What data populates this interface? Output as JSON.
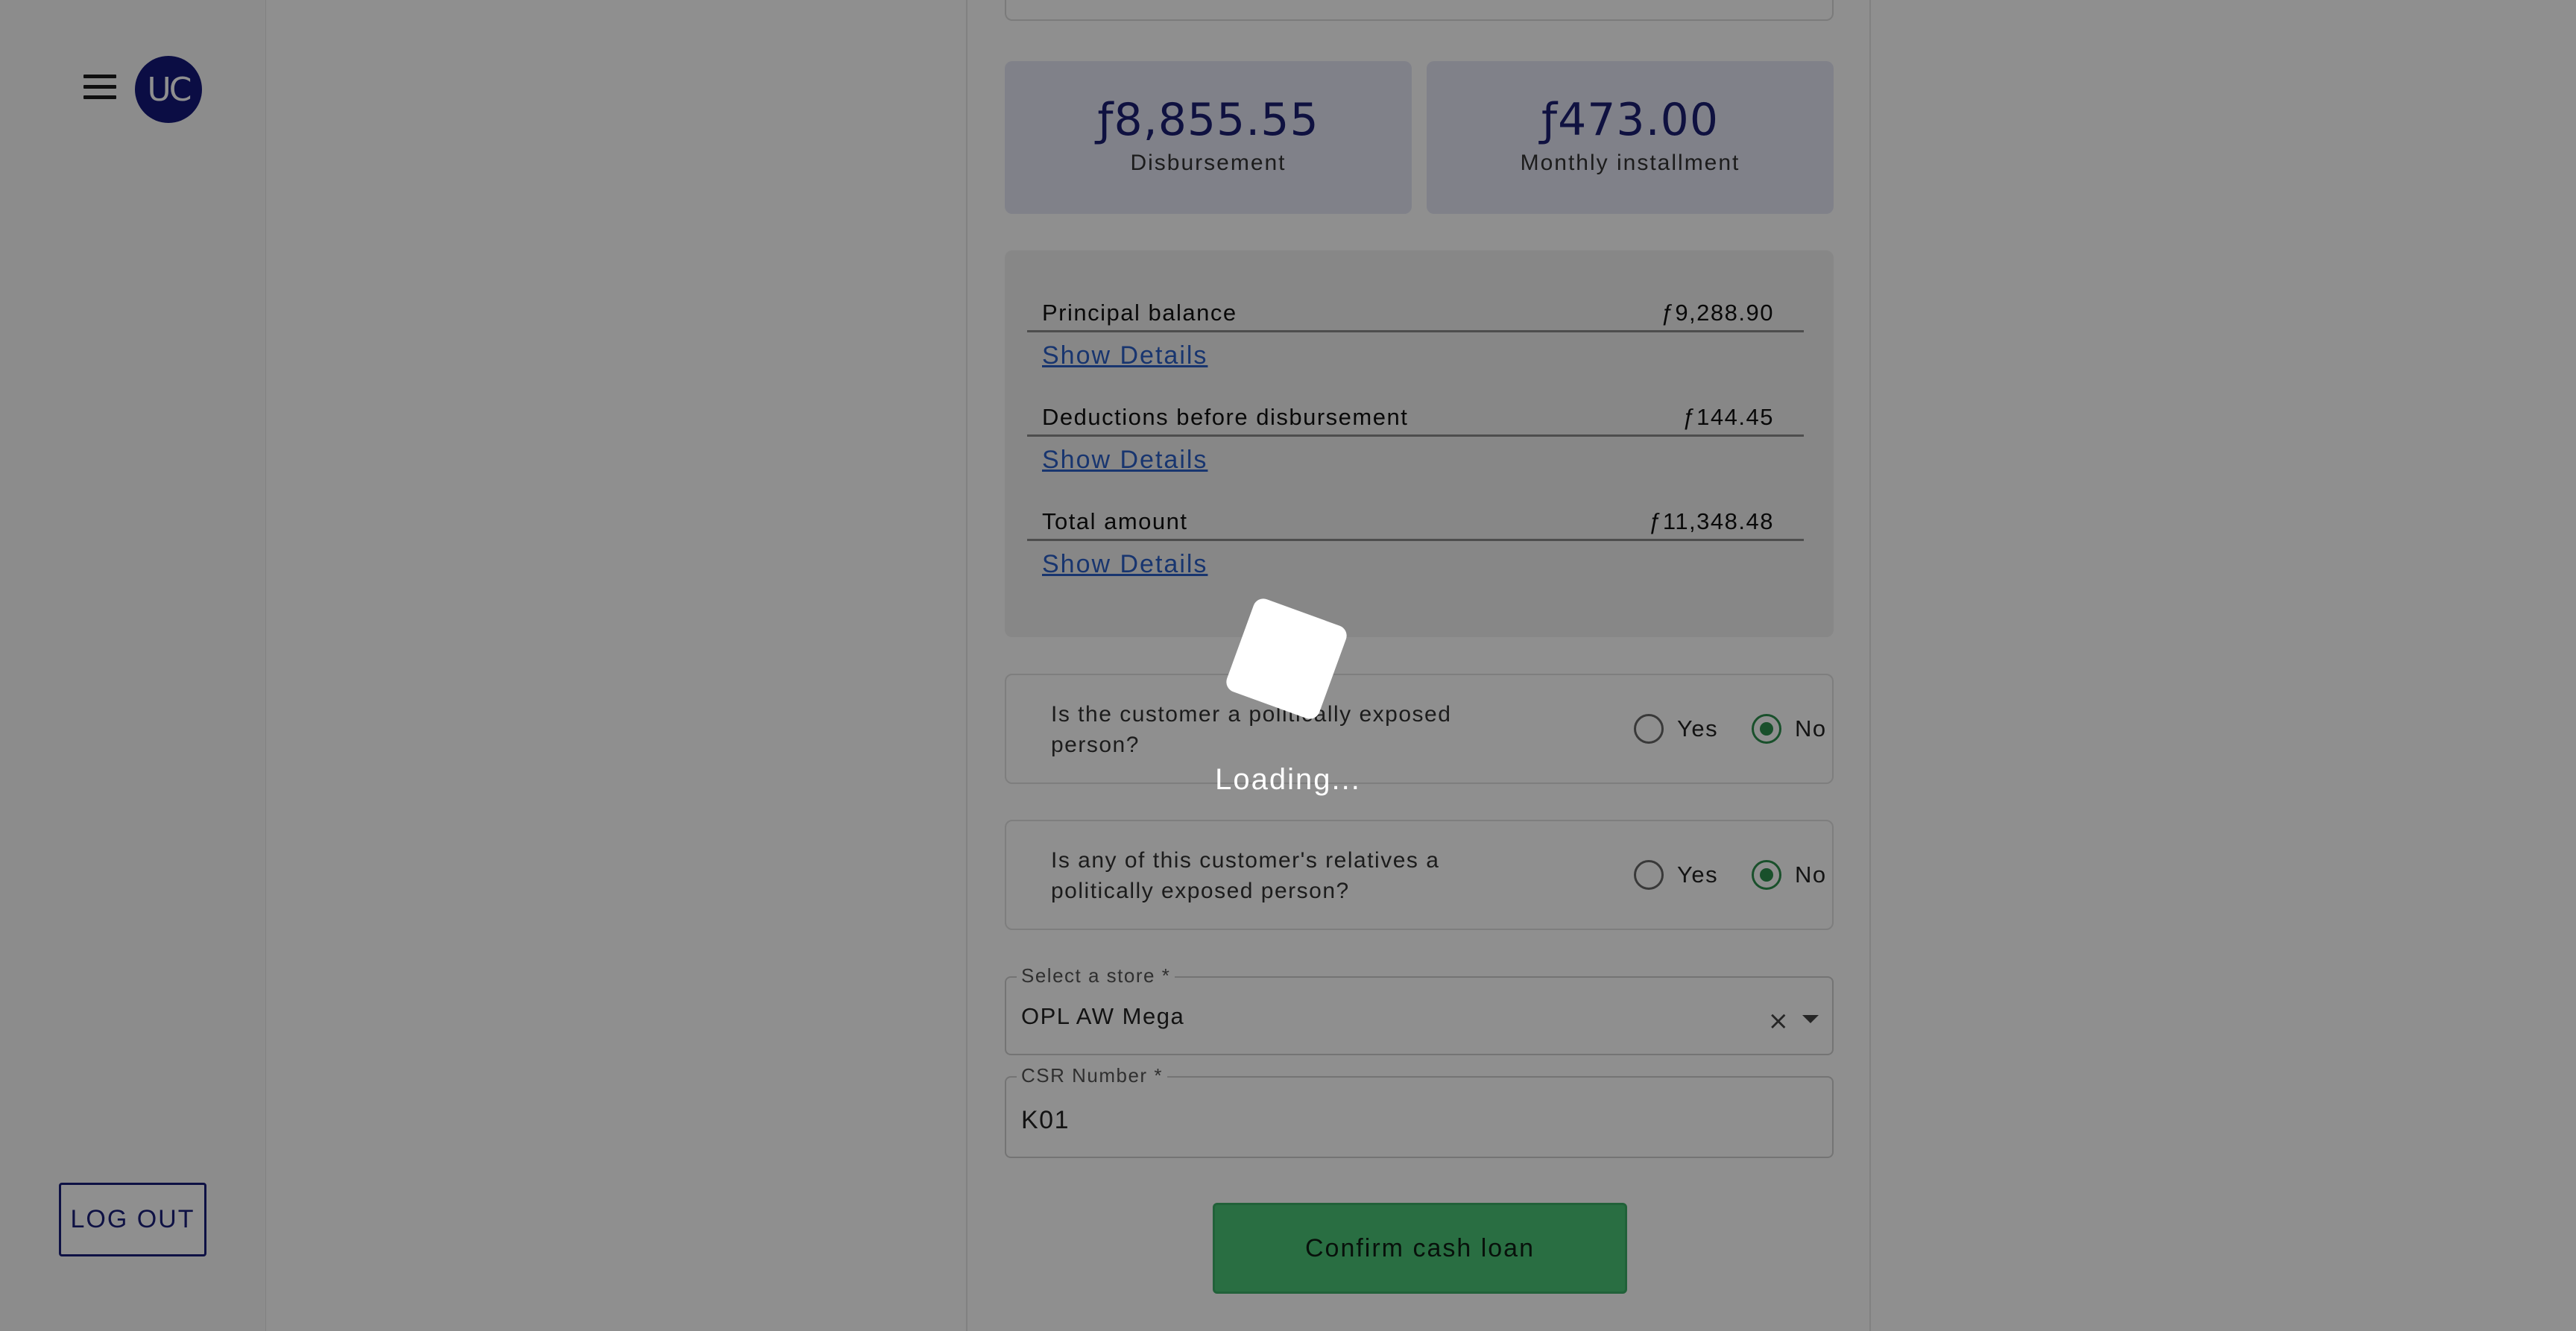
{
  "sidebar": {
    "avatar_initials": "UC",
    "logout_label": "LOG OUT"
  },
  "stats": {
    "disbursement_amount": "ƒ8,855.55",
    "disbursement_label": "Disbursement",
    "installment_amount": "ƒ473.00",
    "installment_label": "Monthly installment"
  },
  "summary": {
    "rows": [
      {
        "label": "Principal balance",
        "value": "ƒ9,288.90",
        "details": "Show Details"
      },
      {
        "label": "Deductions before disbursement",
        "value": "ƒ144.45",
        "details": "Show Details"
      },
      {
        "label": "Total amount",
        "value": "ƒ11,348.48",
        "details": "Show Details"
      }
    ]
  },
  "questions": [
    {
      "text": "Is the customer a politically exposed person?",
      "yes": "Yes",
      "no": "No",
      "selected": "No"
    },
    {
      "text": "Is any of this customer's relatives a politically exposed person?",
      "yes": "Yes",
      "no": "No",
      "selected": "No"
    }
  ],
  "store": {
    "label": "Select a store *",
    "value": "OPL AW Mega"
  },
  "csr": {
    "label": "CSR Number *",
    "value": "K01"
  },
  "confirm_label": "Confirm cash loan",
  "loading": {
    "text": "Loading..."
  },
  "colors": {
    "brand": "#14187a",
    "accent_green": "#2e8f4e",
    "link": "#2b5fc6",
    "card_bg": "#e4e6f5"
  }
}
